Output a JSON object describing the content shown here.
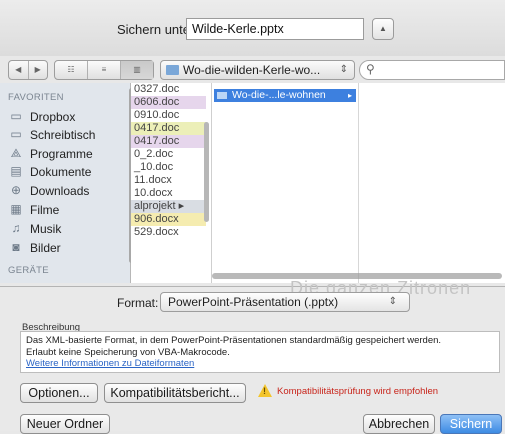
{
  "save_as": {
    "label": "Sichern unter:",
    "filename": "Wilde-Kerle.pptx",
    "expand_glyph": "▲"
  },
  "toolbar": {
    "nav": [
      "◀",
      "▶"
    ],
    "views": [
      "☷",
      "≡",
      "▥"
    ],
    "path": "Wo-die-wilden-Kerle-wo...",
    "path_arrow": "⇕",
    "search_icon": "⚲"
  },
  "sidebar": {
    "favorites_header": "FAVORITEN",
    "items": [
      {
        "label": "Dropbox",
        "icon": "folder-icon",
        "glyph": "▭"
      },
      {
        "label": "Schreibtisch",
        "icon": "desktop-icon",
        "glyph": "▭"
      },
      {
        "label": "Programme",
        "icon": "apps-icon",
        "glyph": "⟁"
      },
      {
        "label": "Dokumente",
        "icon": "document-icon",
        "glyph": "▤"
      },
      {
        "label": "Downloads",
        "icon": "download-icon",
        "glyph": "⊕"
      },
      {
        "label": "Filme",
        "icon": "film-icon",
        "glyph": "▦"
      },
      {
        "label": "Musik",
        "icon": "music-icon",
        "glyph": "♫"
      },
      {
        "label": "Bilder",
        "icon": "camera-icon",
        "glyph": "◙"
      }
    ],
    "devices_header": "GERÄTE"
  },
  "column1": {
    "files": [
      {
        "name": "0327.doc",
        "tag": ""
      },
      {
        "name": "0606.doc",
        "tag": "#e6d6ec"
      },
      {
        "name": "0910.doc",
        "tag": ""
      },
      {
        "name": "0417.doc",
        "tag": "#ecefb8"
      },
      {
        "name": "0417.doc",
        "tag": "#e6d6ec"
      },
      {
        "name": "0_2.doc",
        "tag": ""
      },
      {
        "name": "_10.doc",
        "tag": ""
      },
      {
        "name": "11.docx",
        "tag": ""
      },
      {
        "name": "10.docx",
        "tag": ""
      },
      {
        "name": "alprojekt ▸",
        "tag": ""
      },
      {
        "name": "906.docx",
        "tag": "#f5ecb0"
      },
      {
        "name": "529.docx",
        "tag": ""
      }
    ]
  },
  "column2": {
    "selected_folder": "Wo-die-...le-wohnen",
    "chevron": "▸"
  },
  "ghost_text": "Die ganzen Zitronen",
  "format": {
    "label": "Format:",
    "value": "PowerPoint-Präsentation (.pptx)",
    "arrow": "⇕"
  },
  "description": {
    "label": "Beschreibung",
    "line1": "Das XML-basierte Format, in dem PowerPoint-Präsentationen standardmäßig gespeichert werden.",
    "line2": "Erlaubt keine Speicherung von VBA-Makrocode.",
    "link": "Weitere Informationen zu Dateiformaten"
  },
  "buttons": {
    "options": "Optionen...",
    "compat_report": "Kompatibilitätsbericht...",
    "new_folder": "Neuer Ordner",
    "cancel": "Abbrechen",
    "save": "Sichern"
  },
  "warning": {
    "mark": "!",
    "text": "Kompatibilitätsprüfung wird empfohlen"
  }
}
